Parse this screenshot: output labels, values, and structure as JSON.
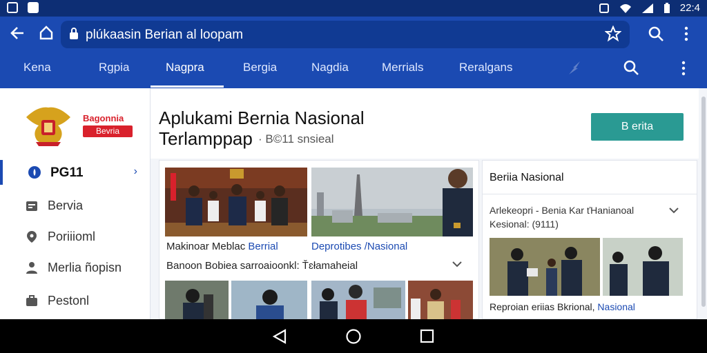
{
  "status_bar": {
    "time": "22:4"
  },
  "browser": {
    "url": "plúkaasin Berian al loopam"
  },
  "nav": {
    "tabs": [
      {
        "label": "Kena"
      },
      {
        "label": "Rgpia"
      },
      {
        "label": "Nagpra"
      },
      {
        "label": "Bergia"
      },
      {
        "label": "Nagdia"
      },
      {
        "label": "Merrials"
      },
      {
        "label": "Reralgans"
      }
    ],
    "active_index": 2
  },
  "sidebar": {
    "brand_title": "Bagonnia",
    "brand_sub": "Bevria",
    "items": [
      {
        "label": "PG11",
        "icon": "shield-icon"
      },
      {
        "label": "Bervia",
        "icon": "calendar-icon"
      },
      {
        "label": "Poriiioml",
        "icon": "pin-icon"
      },
      {
        "label": "Merlia ñopisn",
        "icon": "person-icon"
      },
      {
        "label": "Pestonl",
        "icon": "briefcase-icon"
      }
    ]
  },
  "header": {
    "title_line1": "Aplukami Bernia Nasional",
    "title_line2": "Terlamppap",
    "subtitle": "· B©11 snsieal",
    "cta_label": "B erita"
  },
  "feed": {
    "caption1": "Makinoar Meblac",
    "caption1_link": "Berrial",
    "caption1_right": "Deprotibes /Nasional",
    "caption2": "Banoon Bobiea sarroaioonkl: Ťɛłamaheial"
  },
  "right_panel": {
    "title": "Beriia Nasional",
    "item_line1": "Arlekeopri - Benia Kar ťHanianoal",
    "item_line2": "Kesional: (9111)",
    "caption": "Reproian eriias Bkrional,",
    "caption_link": "Nasional"
  },
  "colors": {
    "primary": "#1b4ab2",
    "cta": "#2a9a93",
    "brand_red": "#d9212c"
  }
}
